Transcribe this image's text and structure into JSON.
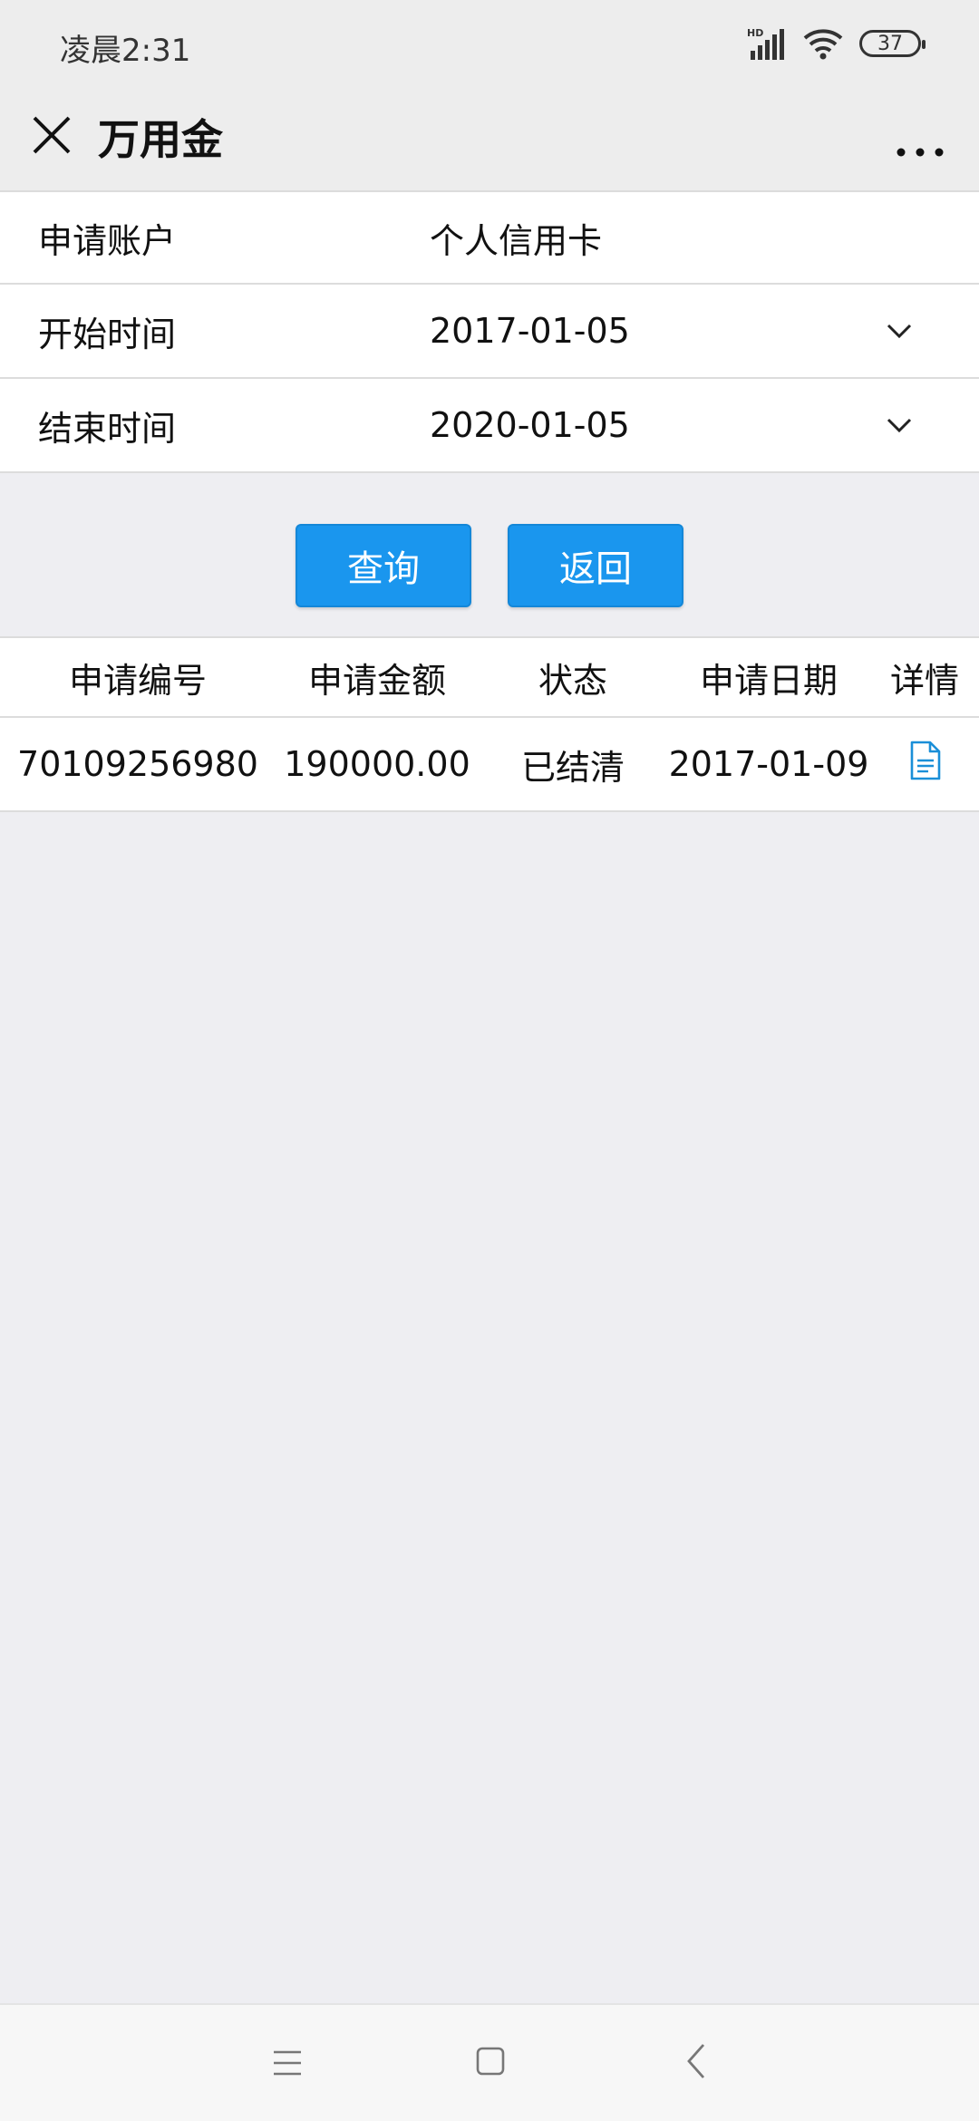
{
  "status_bar": {
    "time": "凌晨2:31",
    "battery": "37",
    "network_label": "HD",
    "icons": [
      "signal-icon",
      "wifi-icon",
      "battery-icon"
    ]
  },
  "nav": {
    "title": "万用金",
    "close_icon": "close-icon",
    "more_icon": "more-icon"
  },
  "form": {
    "account": {
      "label": "申请账户",
      "value": "个人信用卡"
    },
    "start": {
      "label": "开始时间",
      "value": "2017-01-05"
    },
    "end": {
      "label": "结束时间",
      "value": "2020-01-05"
    }
  },
  "buttons": {
    "query": "查询",
    "back": "返回"
  },
  "table": {
    "headers": [
      "申请编号",
      "申请金额",
      "状态",
      "申请日期",
      "详情"
    ],
    "rows": [
      {
        "id": "70109256980",
        "amount": "190000.00",
        "status": "已结清",
        "date": "2017-01-09",
        "detail_icon": "document-icon"
      }
    ]
  },
  "colors": {
    "accent": "#1a96ee",
    "background": "#eeeef2",
    "nav_background": "#ededed"
  }
}
